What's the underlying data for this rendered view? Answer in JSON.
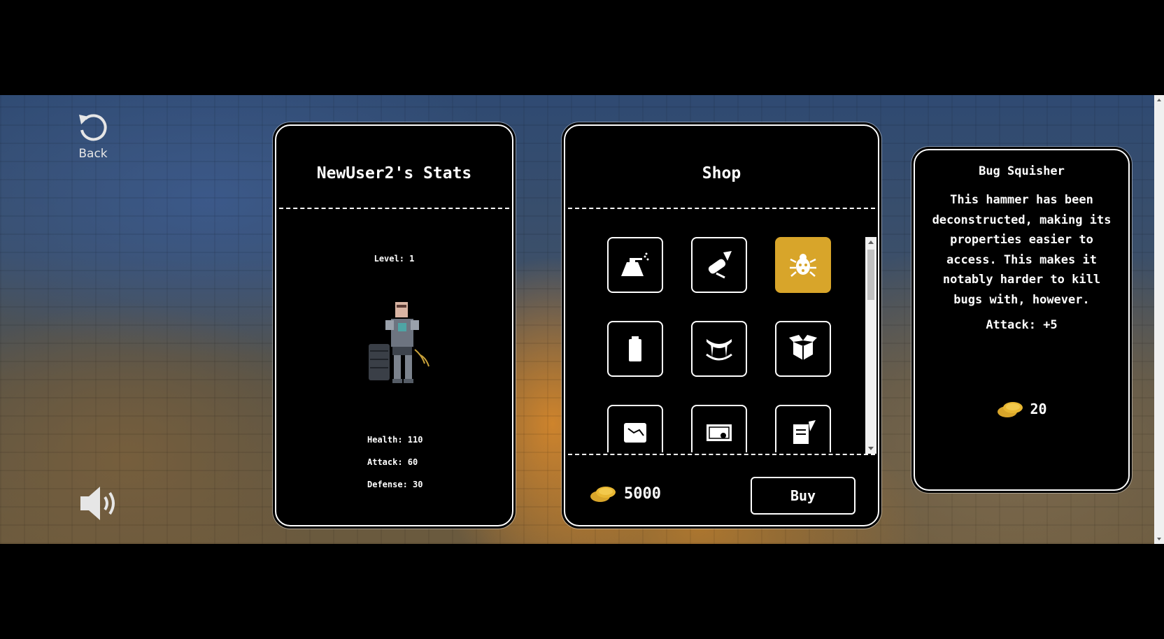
{
  "nav": {
    "back_label": "Back"
  },
  "stats": {
    "title": "NewUser2's Stats",
    "level": "Level: 1",
    "health": "Health: 110",
    "attack": "Attack: 60",
    "defense": "Defense: 30"
  },
  "shop": {
    "title": "Shop",
    "items": [
      {
        "icon": "spray-bottle-icon",
        "selected": false
      },
      {
        "icon": "scroll-quill-icon",
        "selected": false
      },
      {
        "icon": "bug-splat-icon",
        "selected": true
      },
      {
        "icon": "battery-icon",
        "selected": false
      },
      {
        "icon": "fangs-icon",
        "selected": false
      },
      {
        "icon": "open-box-icon",
        "selected": false
      },
      {
        "icon": "map-scroll-icon",
        "selected": false
      },
      {
        "icon": "certificate-icon",
        "selected": false
      },
      {
        "icon": "paper-quill-icon",
        "selected": false
      }
    ],
    "coins": "5000",
    "buy_label": "Buy"
  },
  "detail": {
    "name": "Bug Squisher",
    "description": "This hammer has been deconstructed, making its properties easier to access. This makes it notably harder to kill bugs with, however.",
    "stat": "Attack: +5",
    "price": "20"
  },
  "colors": {
    "accent": "#d8a52a",
    "panel": "#000000",
    "border": "#ffffff"
  }
}
